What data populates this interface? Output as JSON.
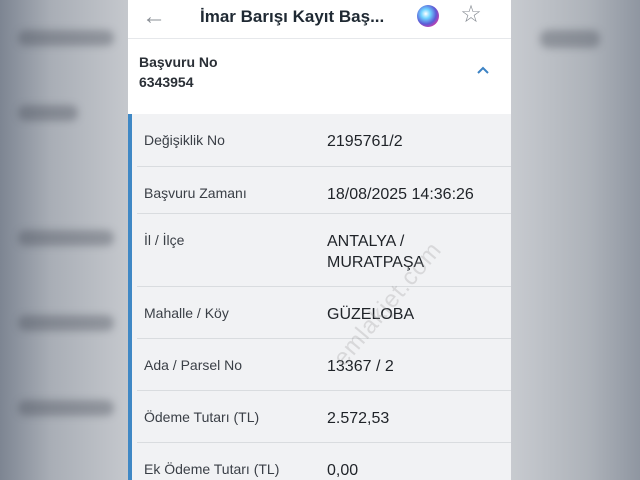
{
  "topbar": {
    "title": "İmar Barışı Kayıt Baş...",
    "back_icon": "←",
    "star_icon": "☆"
  },
  "application": {
    "label": "Başvuru No",
    "number": "6343954"
  },
  "details": [
    {
      "label": "Değişiklik No",
      "value": "2195761/2"
    },
    {
      "label": "Başvuru Zamanı",
      "value": "18/08/2025 14:36:26"
    },
    {
      "label": "İl / İlçe",
      "value": "ANTALYA /",
      "value2": "MURATPAŞA"
    },
    {
      "label": "Mahalle / Köy",
      "value": "GÜZELOBA"
    },
    {
      "label": "Ada / Parsel No",
      "value": "13367 / 2"
    },
    {
      "label": "Ödeme Tutarı (TL)",
      "value": "2.572,53"
    },
    {
      "label": "Ek Ödeme Tutarı (TL)",
      "value": "0,00"
    }
  ],
  "watermark": "emlakjet.com",
  "colors": {
    "accent": "#3f88c5",
    "panel_bg": "#f1f2f4"
  }
}
